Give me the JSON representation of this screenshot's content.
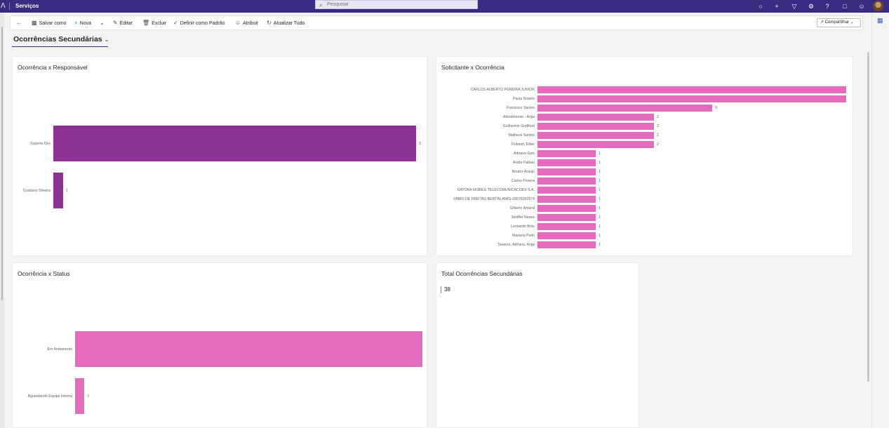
{
  "app": {
    "title": "Serviços"
  },
  "search": {
    "placeholder": "Pesquisar"
  },
  "toolbar": {
    "save_as": "Salvar como",
    "new": "Nova",
    "edit": "Editar",
    "delete": "Excluir",
    "set_default": "Definir como Padrão",
    "assign": "Atribuir",
    "refresh_all": "Atualizar Tudo",
    "share": "Compartilhar"
  },
  "dashboard": {
    "title": "Ocorrências Secundárias"
  },
  "cards": {
    "responsavel": {
      "title": "Ocorrência x Responsável"
    },
    "solicitante": {
      "title": "Solicitante x Ocorrência"
    },
    "status": {
      "title": "Ocorrência x Status"
    },
    "total": {
      "title": "Total Ocorrências Secundárias",
      "value": "38"
    }
  },
  "colors": {
    "purple_bar": "#8b3293",
    "pink_bar": "#e46bbd",
    "topbar": "#3b2a82"
  },
  "chart_data": [
    {
      "type": "bar",
      "orientation": "horizontal",
      "title": "Ocorrência x Responsável",
      "categories": [
        "Suporte Dev",
        "Gusttavo Silveira"
      ],
      "values": [
        37,
        1
      ],
      "value_labels": [
        "3.",
        "1"
      ]
    },
    {
      "type": "bar",
      "orientation": "horizontal",
      "title": "Solicitante x Ocorrência",
      "categories": [
        "CARLOS ALBERTO PEREIRA JUNIOR",
        "Paula Soares",
        "Francisco Santos",
        "Atendimento - Anjia",
        "Guilherme Godfried",
        "Matheus Santos",
        "Robson, Elber",
        "Adriana Gois",
        "Andre Fabiao",
        "Beatriz Araujo",
        "Carlos Pereira",
        "DATORA MOBILE TELECOMUNICACOES S.A.",
        "FABIO DE FREITAS BERTIN-AMIG-29576052874",
        "Gilberto Amaral",
        "Jeniffer Nunes",
        "Leonardo Brito",
        "Mariana Paim",
        "Tavares, Adriana, Anjia"
      ],
      "values": [
        5.3,
        5.3,
        3,
        2,
        2,
        2,
        2,
        1,
        1,
        1,
        1,
        1,
        1,
        1,
        1,
        1,
        1,
        1
      ],
      "value_labels": [
        "",
        "",
        "3",
        "2",
        "2",
        "2",
        "2",
        "1",
        "1",
        "1",
        "1",
        "1",
        "1",
        "1",
        "1",
        "1",
        "1",
        "1"
      ]
    },
    {
      "type": "bar",
      "orientation": "horizontal",
      "title": "Ocorrência x Status",
      "categories": [
        "Em Andamento",
        "Aguardando Equipe Interna"
      ],
      "values": [
        37,
        1
      ],
      "value_labels": [
        "",
        "1"
      ]
    }
  ]
}
